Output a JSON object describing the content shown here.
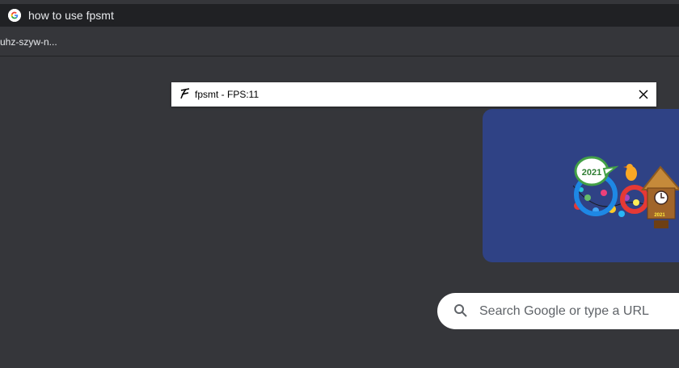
{
  "omnibox": {
    "query": "how to use fpsmt",
    "icon": "google-g-icon"
  },
  "bookmarks": {
    "items": [
      {
        "label": "uhz-szyw-n..."
      }
    ]
  },
  "fps_window": {
    "title": "fpsmt - FPS:11",
    "icon": "fpsmt-icon",
    "close_icon": "close-icon"
  },
  "doodle": {
    "badge_text": "2021",
    "house_label": "2021",
    "background_color": "#2f4285"
  },
  "search": {
    "placeholder": "Search Google or type a URL",
    "icon": "search-icon"
  }
}
